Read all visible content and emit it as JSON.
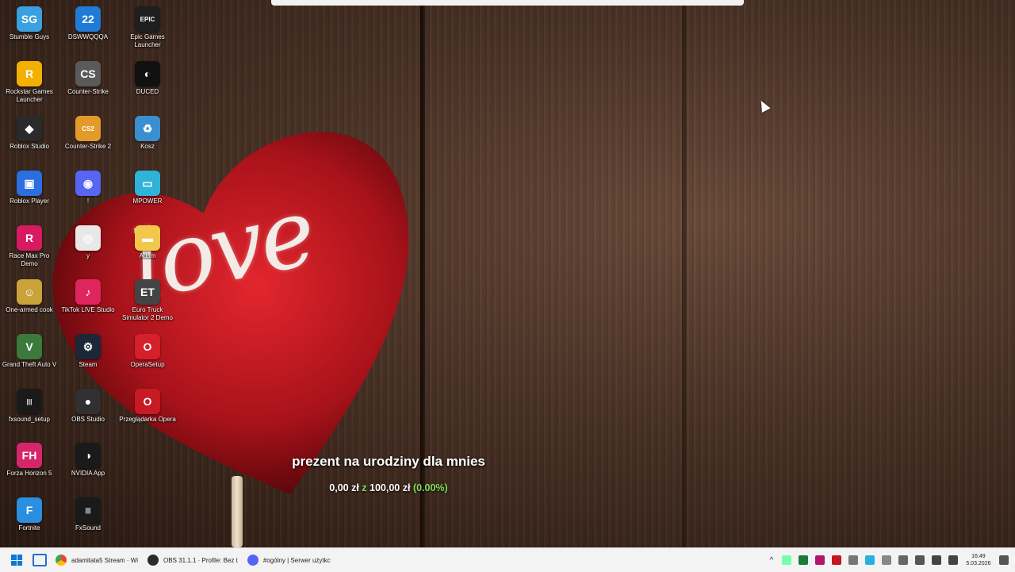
{
  "desktop": {
    "icons": [
      {
        "label": "Stumble Guys",
        "color": "#3aa0e0",
        "glyph": "SG"
      },
      {
        "label": "DSWWQQQA",
        "color": "#1f7bd6",
        "glyph": "22"
      },
      {
        "label": "Epic Games Launcher",
        "color": "#1e1e1e",
        "glyph": "EPIC"
      },
      {
        "label": "Rockstar Games Launcher",
        "color": "#f4b000",
        "glyph": "R"
      },
      {
        "label": "Counter-Strike",
        "color": "#5a5a5a",
        "glyph": "CS"
      },
      {
        "label": "DUCED",
        "color": "#111111",
        "glyph": "◐"
      },
      {
        "label": "Roblox Studio",
        "color": "#2a2a2a",
        "glyph": "◆"
      },
      {
        "label": "Counter-Strike 2",
        "color": "#e39a2a",
        "glyph": "CS2"
      },
      {
        "label": "Kosz",
        "color": "#3a8fd0",
        "glyph": "♻"
      },
      {
        "label": "Roblox Player",
        "color": "#2a6ee0",
        "glyph": "▣"
      },
      {
        "label": "!",
        "color": "#5865f2",
        "glyph": "◉"
      },
      {
        "label": "MPOWER",
        "color": "#2fb3d9",
        "glyph": "▭"
      },
      {
        "label": "Race Max Pro Demo",
        "color": "#d81b60",
        "glyph": "R"
      },
      {
        "label": "y",
        "color": "#e8e8e8",
        "glyph": "◎"
      },
      {
        "label": "Adam",
        "color": "#f2c84b",
        "glyph": "▬"
      },
      {
        "label": "One-armed cook",
        "color": "#c9a23a",
        "glyph": "☺"
      },
      {
        "label": "TikTok LIVE Studio",
        "color": "#e0245e",
        "glyph": "♪"
      },
      {
        "label": "Euro Truck Simulator 2 Demo",
        "color": "#444444",
        "glyph": "ET"
      },
      {
        "label": "Grand Theft Auto V",
        "color": "#3b7a3b",
        "glyph": "V"
      },
      {
        "label": "Steam",
        "color": "#1b2838",
        "glyph": "⚙"
      },
      {
        "label": "OperaSetup",
        "color": "#d3202a",
        "glyph": "O"
      },
      {
        "label": "fxsound_setup",
        "color": "#1a1a1a",
        "glyph": "|||"
      },
      {
        "label": "OBS Studio",
        "color": "#303030",
        "glyph": "●"
      },
      {
        "label": "Przeglądarka Opera",
        "color": "#c81a24",
        "glyph": "O"
      },
      {
        "label": "Forza Horizon 5",
        "color": "#d6266b",
        "glyph": "FH"
      },
      {
        "label": "NVIDIA App",
        "color": "#1a1a1a",
        "glyph": "◑"
      },
      {
        "label": "Fortnite",
        "color": "#2a8fe0",
        "glyph": "F"
      },
      {
        "label": "FxSound",
        "color": "#1a1a1a",
        "glyph": "|||"
      }
    ]
  },
  "donation": {
    "title": "prezent na urodziny dla mnies",
    "current": "0,00 zł",
    "separator": "z",
    "goal": "100,00 zł",
    "percent": "(0.00%)"
  },
  "wallpaper": {
    "text": "love"
  },
  "taskbar": {
    "apps": [
      {
        "label": "adamitata5 Stream · Wi",
        "color": "#e8453c"
      },
      {
        "label": "OBS 31.1.1 · Profile: Bez t",
        "color": "#2b2b2b"
      },
      {
        "label": "#ogólny | Serwer użytkc",
        "color": "#5865f2"
      }
    ],
    "clock": {
      "time": "16:49",
      "date": "5.03.2026"
    }
  }
}
